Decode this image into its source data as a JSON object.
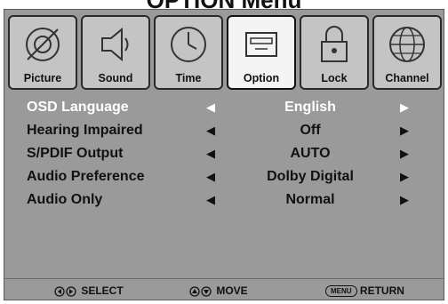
{
  "screen": {
    "title": "OPTION Menu"
  },
  "tabs": [
    {
      "label": "Picture",
      "icon": "picture-icon",
      "active": false
    },
    {
      "label": "Sound",
      "icon": "speaker-icon",
      "active": false
    },
    {
      "label": "Time",
      "icon": "clock-icon",
      "active": false
    },
    {
      "label": "Option",
      "icon": "option-icon",
      "active": true
    },
    {
      "label": "Lock",
      "icon": "padlock-icon",
      "active": false
    },
    {
      "label": "Channel",
      "icon": "globe-icon",
      "active": false
    }
  ],
  "settings": [
    {
      "label": "OSD Language",
      "value": "English",
      "selected": true
    },
    {
      "label": "Hearing Impaired",
      "value": "Off",
      "selected": false
    },
    {
      "label": "S/PDIF Output",
      "value": "AUTO",
      "selected": false
    },
    {
      "label": "Audio Preference",
      "value": "Dolby Digital",
      "selected": false
    },
    {
      "label": "Audio Only",
      "value": "Normal",
      "selected": false
    }
  ],
  "footer": {
    "select_label": "SELECT",
    "move_label": "MOVE",
    "menu_key": "MENU",
    "return_label": "RETURN"
  },
  "colors": {
    "background": "#9a9a9a",
    "active_tab": "#f4f4f4",
    "tab": "#c4c4c4",
    "selected_text": "#ffffff"
  }
}
